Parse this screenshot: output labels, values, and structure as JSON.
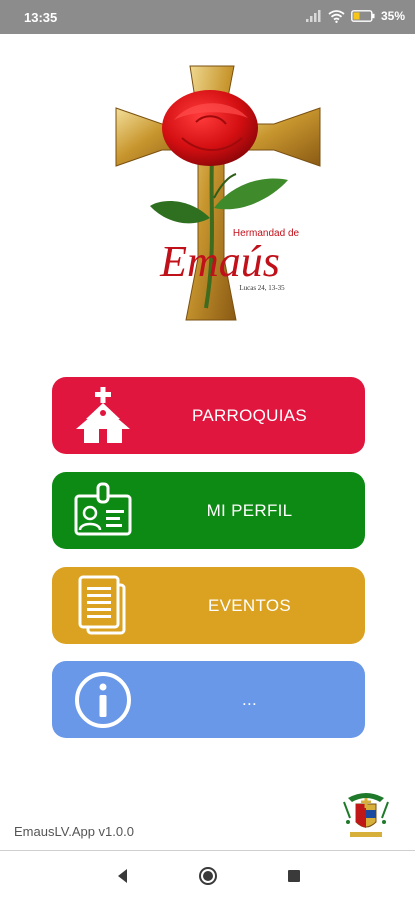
{
  "status_bar": {
    "time": "13:35",
    "battery_percent": "35%",
    "icons": [
      "signal-icon",
      "wifi-icon",
      "battery-icon"
    ]
  },
  "logo": {
    "title_small": "Hermandad de",
    "title_large": "Emaús",
    "reference": "Lucas 24, 13-35"
  },
  "menu": {
    "items": [
      {
        "label": "PARROQUIAS",
        "icon": "church-icon",
        "color": "#e0163f"
      },
      {
        "label": "MI PERFIL",
        "icon": "id-badge-icon",
        "color": "#0c8a13"
      },
      {
        "label": "EVENTOS",
        "icon": "documents-icon",
        "color": "#daa220"
      },
      {
        "label": "...",
        "icon": "info-icon",
        "color": "#6a98e8"
      }
    ]
  },
  "footer": {
    "version": "EmausLV.App v1.0.0",
    "crest_icon": "bishop-coat-of-arms-icon"
  },
  "nav": {
    "icons": [
      "back-icon",
      "home-icon",
      "recents-icon"
    ]
  }
}
